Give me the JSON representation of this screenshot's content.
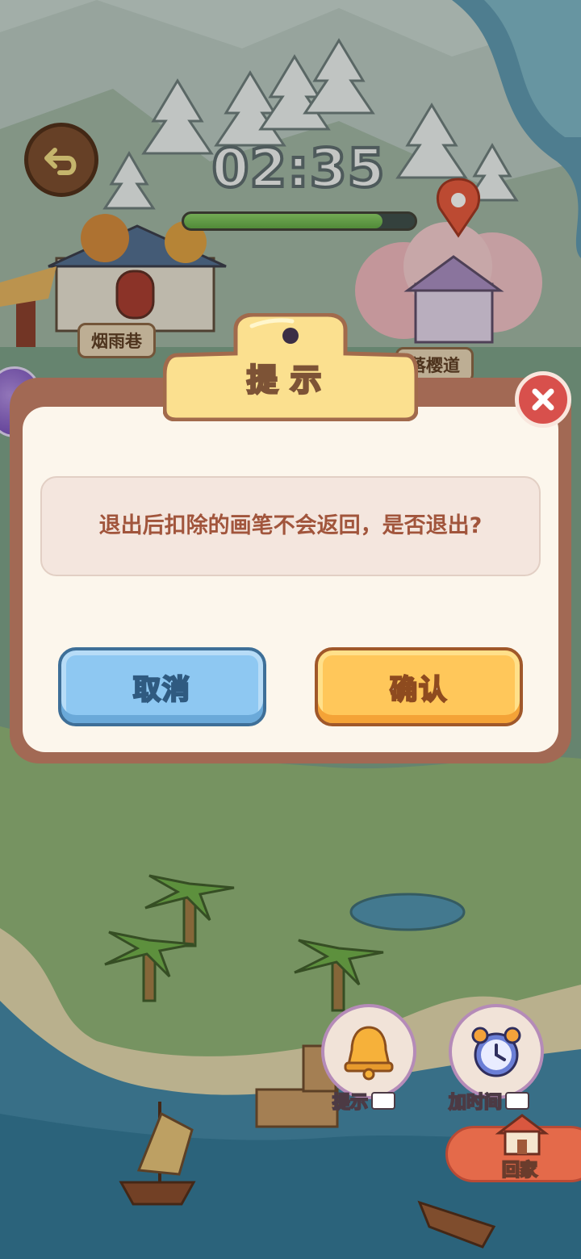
{
  "hud": {
    "timer": "02:35",
    "progress_fraction": 0.86
  },
  "map": {
    "location_left": "烟雨巷",
    "location_right": "落樱道"
  },
  "dialog": {
    "title": "提示",
    "message": "退出后扣除的画笔不会返回，是否退出?",
    "cancel_label": "取消",
    "confirm_label": "确认"
  },
  "tools": {
    "hint_label": "提示",
    "add_time_label": "加时间",
    "home_label": "回家"
  },
  "icons": {
    "back": "back-arrow-icon",
    "close": "close-icon",
    "hint": "bell-icon",
    "add_time": "alarm-clock-icon",
    "video": "video-icon",
    "home": "house-icon",
    "location": "map-pin-icon"
  },
  "colors": {
    "cancel_button": "#8ec8f2",
    "confirm_button": "#ffc75a",
    "close_button": "#d8504c",
    "dialog_frame": "#a26954",
    "message_text": "#a1553c"
  }
}
